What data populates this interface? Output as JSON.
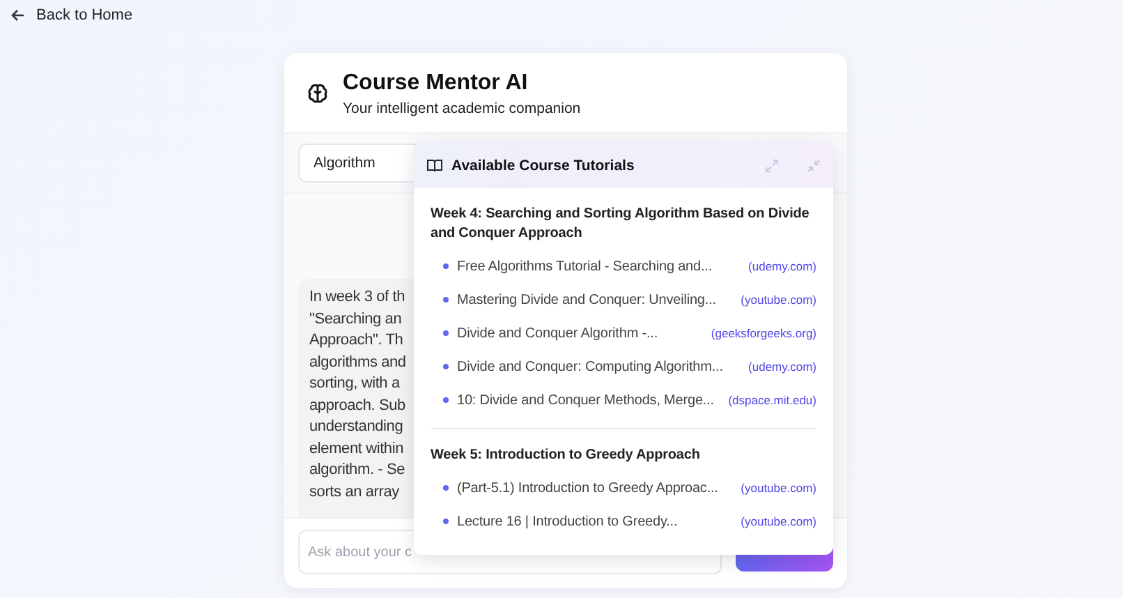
{
  "back_link": "Back to Home",
  "header": {
    "title": "Course Mentor AI",
    "subtitle": "Your intelligent academic companion"
  },
  "course_select": {
    "value": "Algorithm"
  },
  "message_lines": [
    "In week 3 of th",
    "\"Searching an",
    "Approach\". Th",
    "algorithms and",
    "sorting, with a",
    "approach. Sub",
    "understanding",
    "element within",
    "algorithm. - Se",
    "sorts an array"
  ],
  "input": {
    "placeholder": "Ask about your c"
  },
  "tutorials": {
    "title": "Available Course Tutorials",
    "sections": [
      {
        "title": "Week 4: Searching and Sorting Algorithm Based on Divide and Conquer Approach",
        "items": [
          {
            "title": "Free Algorithms Tutorial - Searching and...",
            "source": "(udemy.com)"
          },
          {
            "title": "Mastering Divide and Conquer: Unveiling...",
            "source": "(youtube.com)"
          },
          {
            "title": "Divide and Conquer Algorithm -...",
            "source": "(geeksforgeeks.org)"
          },
          {
            "title": "Divide and Conquer: Computing Algorithm...",
            "source": "(udemy.com)"
          },
          {
            "title": "10: Divide and Conquer Methods, Merge...",
            "source": "(dspace.mit.edu)"
          }
        ]
      },
      {
        "title": "Week 5: Introduction to Greedy Approach",
        "items": [
          {
            "title": "(Part-5.1) Introduction to Greedy Approac...",
            "source": "(youtube.com)"
          },
          {
            "title": "Lecture 16 | Introduction to Greedy...",
            "source": "(youtube.com)"
          }
        ]
      }
    ]
  }
}
